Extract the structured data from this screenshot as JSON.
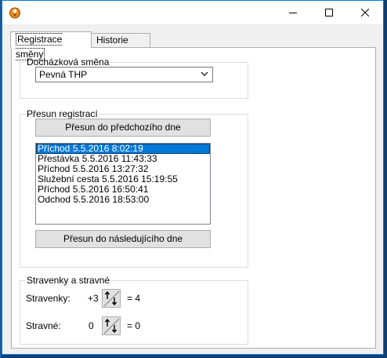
{
  "tabs": {
    "active_label": "Registrace směny",
    "inactive_label": "Historie změn"
  },
  "shift_group": {
    "legend": "Docházková směna",
    "selected_value": "Pevná THP"
  },
  "move_group": {
    "legend": "Přesun registrací",
    "prev_button": "Přesun do předchozího dne",
    "next_button": "Přesun do následujícího dne",
    "items": [
      "Příchod 5.5.2016 8:02:19",
      "Přestávka 5.5.2016 11:43:33",
      "Příchod 5.5.2016 13:27:32",
      "Služební cesta 5.5.2016 15:19:55",
      "Příchod 5.5.2016 16:50:41",
      "Odchod 5.5.2016 18:53:00"
    ],
    "selected_index": 0
  },
  "meal_group": {
    "legend": "Stravenky a stravné",
    "vouchers_label": "Stravenky:",
    "vouchers_delta": "+3",
    "vouchers_total": "= 4",
    "allowance_label": "Stravné:",
    "allowance_delta": "0",
    "allowance_total": "= 0"
  },
  "icons": {
    "app": "app-icon",
    "minimize": "minimize-icon",
    "maximize": "maximize-icon",
    "close": "close-icon",
    "spin": "up-down-arrows-icon"
  },
  "colors": {
    "selection": "#0078d7",
    "window_border": "#0078d7",
    "desktop": "#0f3f73"
  }
}
